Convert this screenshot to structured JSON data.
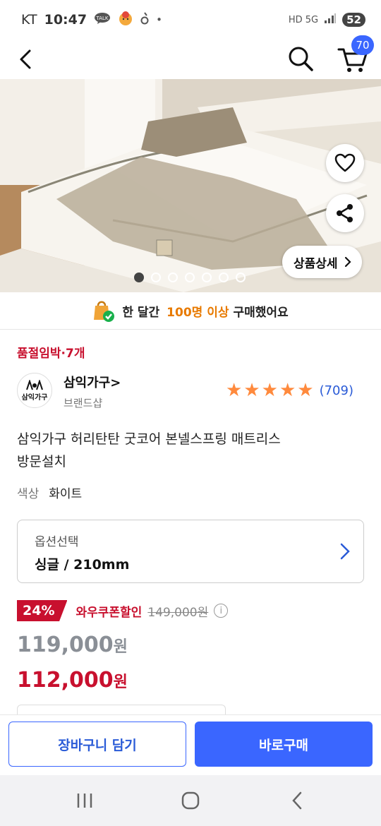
{
  "status_bar": {
    "carrier": "KT",
    "time": "10:47",
    "notif_icons": [
      "talk-icon",
      "character-icon",
      "app-icon"
    ],
    "dot": "•",
    "network": "HD 5G",
    "battery": "52"
  },
  "header": {
    "cart_count": "70"
  },
  "hero": {
    "detail_button": "상품상세",
    "image_count": 7,
    "active_index": 0
  },
  "notice": {
    "prefix": "한 달간",
    "highlight": "100명 이상",
    "suffix": "구매했어요"
  },
  "low_stock": "품절임박·7개",
  "brand": {
    "logo_text": "삼익가구",
    "name": "삼익가구>",
    "sub": "브랜드샵",
    "stars": 5,
    "review_count": "(709)"
  },
  "product": {
    "title_line1": "삼익가구 허리탄탄 굿코어 본넬스프링 매트리스",
    "title_line2": "방문설치",
    "color_label": "색상",
    "color_value": "화이트"
  },
  "option": {
    "label": "옵션선택",
    "value": "싱글 / 210mm"
  },
  "price": {
    "discount": "24%",
    "coupon_label": "와우쿠폰할인",
    "original": "149,000원",
    "before_value": "119,000",
    "final_value": "112,000",
    "currency": "원"
  },
  "bottom": {
    "add_cart": "장바구니 담기",
    "buy_now": "바로구매"
  },
  "colors": {
    "accent_blue": "#3a66ff",
    "sale_red": "#c8102e",
    "star_orange": "#ff8a3d"
  }
}
